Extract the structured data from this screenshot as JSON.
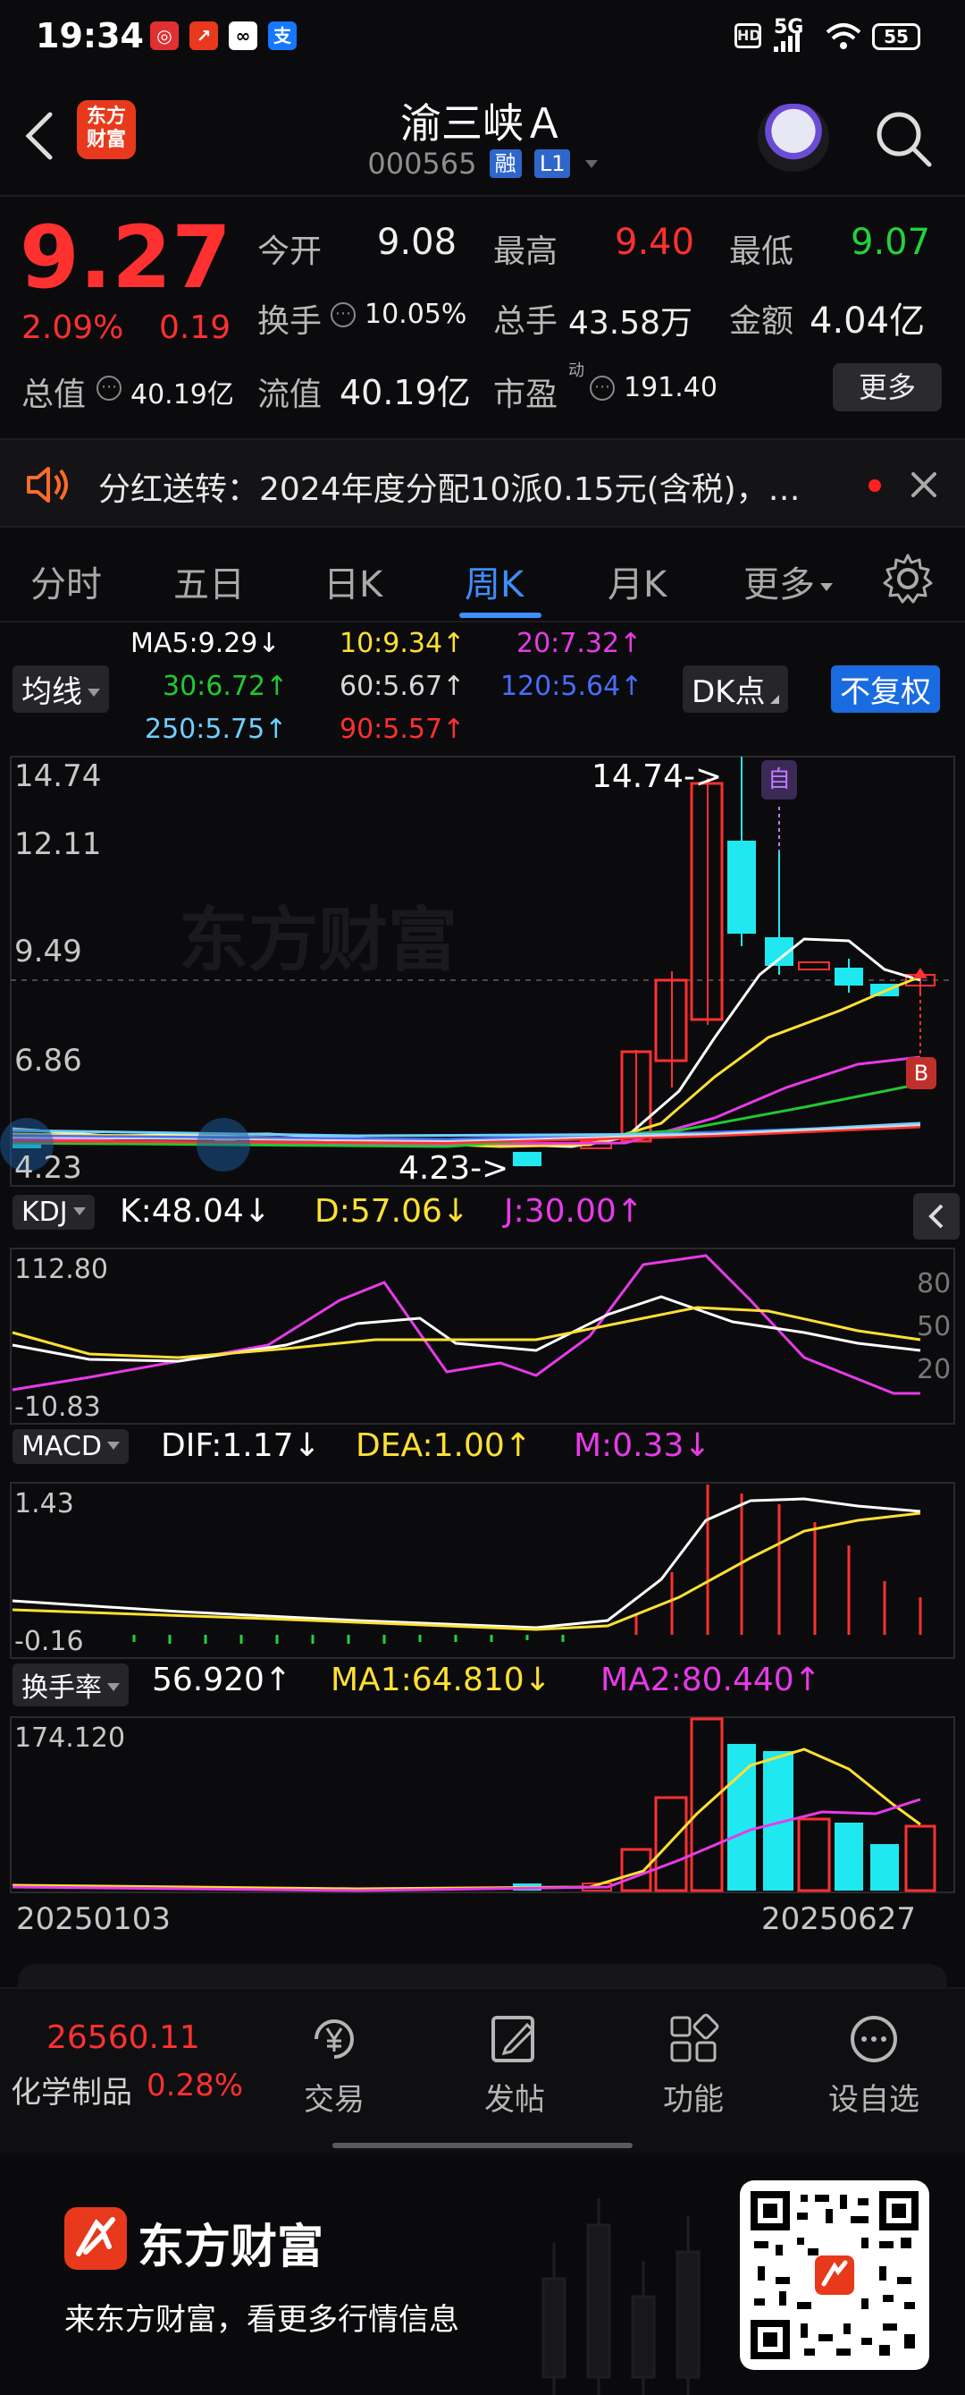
{
  "status_bar": {
    "time": "19:34",
    "battery": "55",
    "network": "5G"
  },
  "header": {
    "back_icon": "chevron-left-icon",
    "brand_logo_text": [
      "东方",
      "财富"
    ],
    "title": "渝三峡Ａ",
    "code": "000565",
    "tag_rong": "融",
    "tag_level": "L1",
    "assistant_icon": "robot-avatar-icon",
    "search_icon": "search-icon"
  },
  "quote": {
    "price": "9.27",
    "change_pct": "2.09%",
    "change_amt": "0.19",
    "open_label": "今开",
    "open": "9.08",
    "high_label": "最高",
    "high": "9.40",
    "low_label": "最低",
    "low": "9.07",
    "turnover_label": "换手",
    "turnover": "10.05%",
    "volume_label": "总手",
    "volume": "43.58万",
    "amount_label": "金额",
    "amount": "4.04亿",
    "mktcap_label": "总值",
    "mktcap": "40.19亿",
    "float_label": "流值",
    "float": "40.19亿",
    "pe_label": "市盈",
    "pe_sup": "动",
    "pe": "191.40",
    "more_button": "更多"
  },
  "notice": {
    "text": "分红送转：2024年度分配10派0.15元(含税)，…"
  },
  "tabs": [
    {
      "label": "分时",
      "active": false
    },
    {
      "label": "五日",
      "active": false
    },
    {
      "label": "日K",
      "active": false
    },
    {
      "label": "周K",
      "active": true
    },
    {
      "label": "月K",
      "active": false
    },
    {
      "label": "更多",
      "active": false
    }
  ],
  "ma_legend": {
    "selector": "均线",
    "items": [
      {
        "text": "MA5:9.29↓",
        "color": "#ffffff"
      },
      {
        "text": "10:9.34↑",
        "color": "#ffe033"
      },
      {
        "text": "20:7.32↑",
        "color": "#e83ae8"
      },
      {
        "text": "30:6.72↑",
        "color": "#22c832"
      },
      {
        "text": "60:5.67↑",
        "color": "#d8d8d8"
      },
      {
        "text": "120:5.64↑",
        "color": "#4a6cff"
      },
      {
        "text": "250:5.75↑",
        "color": "#6fd0ff"
      },
      {
        "text": "90:5.57↑",
        "color": "#ff3030"
      }
    ],
    "dk_button": "DK点",
    "adjust_button": "不复权"
  },
  "kline": {
    "y_labels": [
      "14.74",
      "12.11",
      "9.49",
      "6.86",
      "4.23"
    ],
    "high_annotation": "14.74->",
    "low_annotation": "4.23->",
    "marker_zi": "自",
    "marker_b": "B",
    "watermark": "东方财富"
  },
  "kdj": {
    "selector": "KDJ",
    "k": "K:48.04↓",
    "d": "D:57.06↓",
    "j": "J:30.00↑",
    "y_top": "112.80",
    "y_bottom": "-10.83",
    "levels": [
      "80",
      "50",
      "20"
    ]
  },
  "macd": {
    "selector": "MACD",
    "dif": "DIF:1.17↓",
    "dea": "DEA:1.00↑",
    "m": "M:0.33↓",
    "y_top": "1.43",
    "y_bottom": "-0.16"
  },
  "turnover_rate": {
    "selector": "换手率",
    "value": "56.920↑",
    "ma1": "MA1:64.810↓",
    "ma2": "MA2:80.440↑",
    "y_top": "174.120"
  },
  "x_axis": {
    "start": "20250103",
    "end": "20250627"
  },
  "bottom_nav": {
    "index_value": "26560.11",
    "index_name": "化学制品",
    "index_change": "0.28%",
    "items": [
      {
        "label": "交易",
        "icon": "yen-refresh-icon"
      },
      {
        "label": "发帖",
        "icon": "edit-icon"
      },
      {
        "label": "功能",
        "icon": "apps-grid-icon"
      },
      {
        "label": "设自选",
        "icon": "more-circle-icon"
      }
    ]
  },
  "footer": {
    "brand": "东方财富",
    "slogan": "来东方财富，看更多行情信息"
  }
}
